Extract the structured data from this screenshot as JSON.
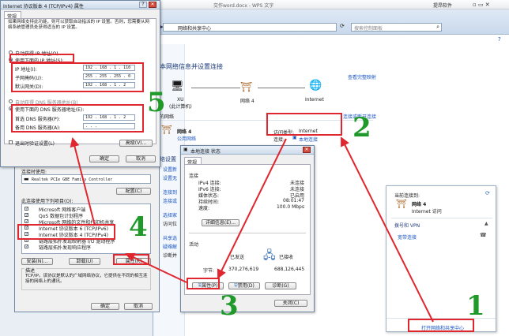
{
  "wps": {
    "title": "交作word.docx - WPS 文字",
    "right_text": "提昂软件"
  },
  "explorer": {
    "breadcrumb": "网络和共享中心",
    "search_placeholder": "搜索控制面板",
    "heading": "本网络信息并设置连接",
    "map_link": "查看完整映射",
    "nodes": [
      {
        "name": "XU",
        "sub": "(此计算机)"
      },
      {
        "name": "网络 4",
        "sub": ""
      },
      {
        "name": "Internet",
        "sub": ""
      }
    ],
    "active_label": "的网络",
    "connect_link": "连接或断开连接",
    "network_name": "网络 4",
    "network_type": "公用网络",
    "access_type_label": "访问类型:",
    "access_type_value": "Internet",
    "connections_label": "连接:",
    "connections_value": "本地连接",
    "side_items": [
      "络设置",
      "设置新",
      "设置无",
      "连接到",
      "连接或",
      "选择家",
      "访问位",
      "共享选",
      "疑难解",
      "诊断并"
    ],
    "side_heading": "络设置"
  },
  "ipv4": {
    "title": "Internet 协议版本 4 (TCP/IPv4) 属性",
    "tab": "常规",
    "intro": "如果网络支持此功能，则可以获取自动指派的 IP 设置。否则，您需要从网络系统管理员处获得适当的 IP 设置。",
    "auto_ip": "自动获得 IP 地址(O)",
    "manual_ip": "使用下面的 IP 地址(S):",
    "ip_label": "IP 地址(I):",
    "ip_value": "192 . 168 .  1  . 110",
    "mask_label": "子网掩码(U):",
    "mask_value": "255 . 255 . 255 .  0",
    "gw_label": "默认网关(D):",
    "gw_value": "192 . 168 .  1  .  2",
    "auto_dns": "自动获得 DNS 服务器地址(B)",
    "manual_dns": "使用下面的 DNS 服务器地址(E):",
    "dns1_label": "首选 DNS 服务器(P):",
    "dns1_value": "192 . 168 .  1  .  2",
    "dns2_label": "备用 DNS 服务器(A):",
    "dns2_value": " .   .   . ",
    "validate": "退出时验证设置(L)",
    "advanced": "高级(V)...",
    "ok": "确定",
    "cancel": "取消"
  },
  "lan": {
    "connect_using_label": "连接时使用:",
    "adapter": "Realtek PCIe GBE Family Controller",
    "configure": "配置(C)",
    "items_label": "此连接使用下列项目(O):",
    "items": [
      "Microsoft 网络客户端",
      "QoS 数据包计划程序",
      "Microsoft 网络的文件和打印机共享",
      "Internet 协议版本 6 (TCP/IPv6)",
      "Internet 协议版本 4 (TCP/IPv4)",
      "链路层拓扑发现映射器 I/O 驱动程序",
      "链路层拓扑发现响应程序"
    ],
    "install": "安装(N)...",
    "uninstall": "卸载(U)",
    "properties": "属性(R)",
    "desc_label": "描述",
    "desc": "TCP/IP。该协议是默认的广域网络协议，它提供在不同的相互连接的网络上的通讯。",
    "ok": "确定",
    "cancel": "取消"
  },
  "status": {
    "title": "本地连接 状态",
    "tab": "常规",
    "conn_label": "连接",
    "rows": [
      {
        "k": "IPv4 连接:",
        "v": "未连接"
      },
      {
        "k": "IPv6 连接:",
        "v": "未连接"
      },
      {
        "k": "媒体状态:",
        "v": "已启用"
      },
      {
        "k": "持续时间:",
        "v": "08:01:47"
      },
      {
        "k": "速度:",
        "v": "100.0 Mbps"
      }
    ],
    "details": "详细信息(E)...",
    "activity_label": "活动",
    "sent": "已发送",
    "received": "已接收",
    "bytes_label": "字节:",
    "bytes_sent": "370,276,619",
    "bytes_recv": "688,126,445",
    "properties": "属性(P)",
    "disable": "禁用(D)",
    "diagnose": "诊断(G)",
    "close": "关闭(C)"
  },
  "flyout": {
    "current": "当前连接到:",
    "net_name": "网络 4",
    "net_access": "Internet 访问",
    "dialup": "拨号和 VPN",
    "broadband": "宽带连接",
    "open_center": "打开网络和共享中心"
  },
  "annotations": {
    "n1": "1",
    "n2": "2",
    "n3": "3",
    "n4": "4",
    "n5": "5"
  },
  "colors": {
    "annotation_red": "#e0262e",
    "annotation_green": "#1f9a2a",
    "link_blue": "#1a55c4"
  }
}
